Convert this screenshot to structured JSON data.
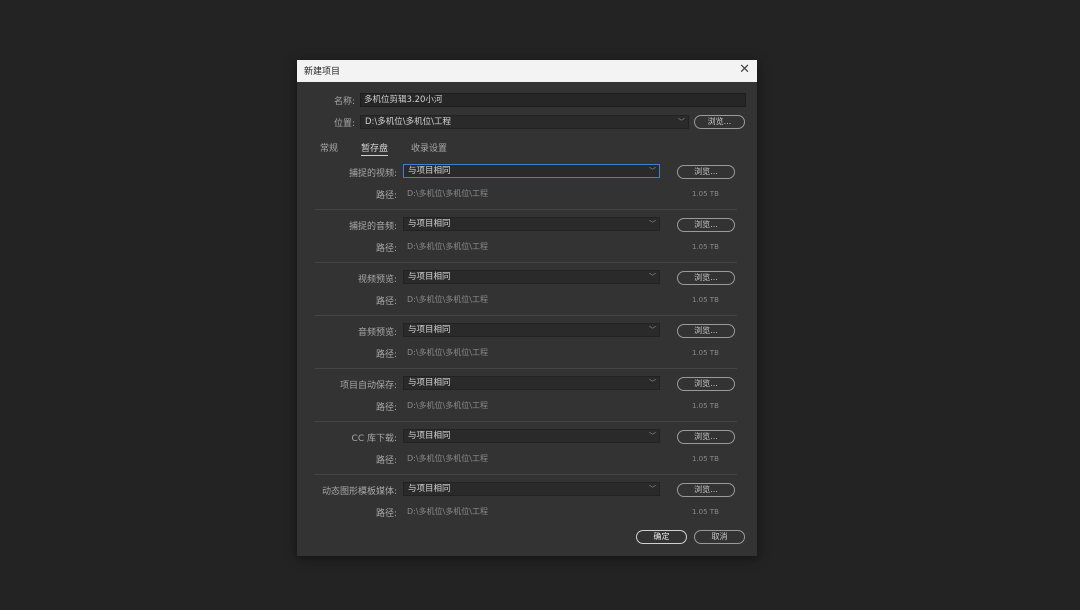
{
  "dialog": {
    "title": "新建项目",
    "close_glyph": "✕",
    "name_label": "名称:",
    "name_value": "多机位剪辑3.20小河",
    "location_label": "位置:",
    "location_value": "D:\\多机位\\多机位\\工程",
    "browse_label": "浏览...",
    "tabs": [
      "常规",
      "暂存盘",
      "收录设置"
    ],
    "path_label": "路径:",
    "rows": [
      {
        "label": "捕捉的视频:",
        "value": "与项目相同",
        "path": "D:\\多机位\\多机位\\工程",
        "size": "1.05 TB"
      },
      {
        "label": "捕捉的音频:",
        "value": "与项目相同",
        "path": "D:\\多机位\\多机位\\工程",
        "size": "1.05 TB"
      },
      {
        "label": "视频预览:",
        "value": "与项目相同",
        "path": "D:\\多机位\\多机位\\工程",
        "size": "1.05 TB"
      },
      {
        "label": "音频预览:",
        "value": "与项目相同",
        "path": "D:\\多机位\\多机位\\工程",
        "size": "1.05 TB"
      },
      {
        "label": "项目自动保存:",
        "value": "与项目相同",
        "path": "D:\\多机位\\多机位\\工程",
        "size": "1.05 TB"
      },
      {
        "label": "CC 库下载:",
        "value": "与项目相同",
        "path": "D:\\多机位\\多机位\\工程",
        "size": "1.05 TB"
      },
      {
        "label": "动态图形模板媒体:",
        "value": "与项目相同",
        "path": "D:\\多机位\\多机位\\工程",
        "size": "1.05 TB"
      }
    ],
    "ok_label": "确定",
    "cancel_label": "取消"
  }
}
